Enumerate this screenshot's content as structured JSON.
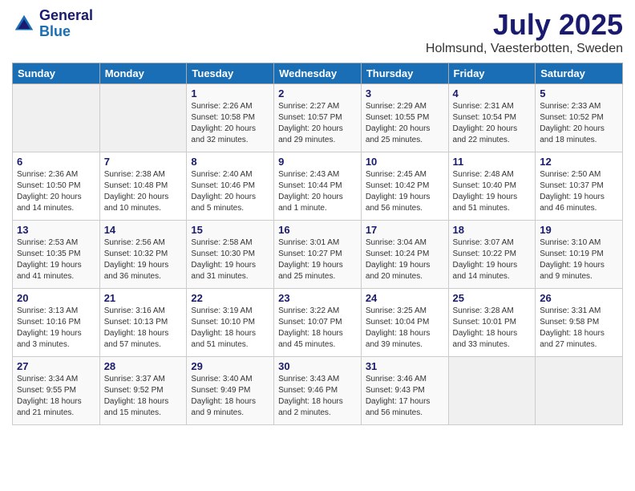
{
  "header": {
    "logo_line1": "General",
    "logo_line2": "Blue",
    "month": "July 2025",
    "location": "Holmsund, Vaesterbotten, Sweden"
  },
  "days_of_week": [
    "Sunday",
    "Monday",
    "Tuesday",
    "Wednesday",
    "Thursday",
    "Friday",
    "Saturday"
  ],
  "weeks": [
    [
      {
        "num": "",
        "info": ""
      },
      {
        "num": "",
        "info": ""
      },
      {
        "num": "1",
        "info": "Sunrise: 2:26 AM\nSunset: 10:58 PM\nDaylight: 20 hours\nand 32 minutes."
      },
      {
        "num": "2",
        "info": "Sunrise: 2:27 AM\nSunset: 10:57 PM\nDaylight: 20 hours\nand 29 minutes."
      },
      {
        "num": "3",
        "info": "Sunrise: 2:29 AM\nSunset: 10:55 PM\nDaylight: 20 hours\nand 25 minutes."
      },
      {
        "num": "4",
        "info": "Sunrise: 2:31 AM\nSunset: 10:54 PM\nDaylight: 20 hours\nand 22 minutes."
      },
      {
        "num": "5",
        "info": "Sunrise: 2:33 AM\nSunset: 10:52 PM\nDaylight: 20 hours\nand 18 minutes."
      }
    ],
    [
      {
        "num": "6",
        "info": "Sunrise: 2:36 AM\nSunset: 10:50 PM\nDaylight: 20 hours\nand 14 minutes."
      },
      {
        "num": "7",
        "info": "Sunrise: 2:38 AM\nSunset: 10:48 PM\nDaylight: 20 hours\nand 10 minutes."
      },
      {
        "num": "8",
        "info": "Sunrise: 2:40 AM\nSunset: 10:46 PM\nDaylight: 20 hours\nand 5 minutes."
      },
      {
        "num": "9",
        "info": "Sunrise: 2:43 AM\nSunset: 10:44 PM\nDaylight: 20 hours\nand 1 minute."
      },
      {
        "num": "10",
        "info": "Sunrise: 2:45 AM\nSunset: 10:42 PM\nDaylight: 19 hours\nand 56 minutes."
      },
      {
        "num": "11",
        "info": "Sunrise: 2:48 AM\nSunset: 10:40 PM\nDaylight: 19 hours\nand 51 minutes."
      },
      {
        "num": "12",
        "info": "Sunrise: 2:50 AM\nSunset: 10:37 PM\nDaylight: 19 hours\nand 46 minutes."
      }
    ],
    [
      {
        "num": "13",
        "info": "Sunrise: 2:53 AM\nSunset: 10:35 PM\nDaylight: 19 hours\nand 41 minutes."
      },
      {
        "num": "14",
        "info": "Sunrise: 2:56 AM\nSunset: 10:32 PM\nDaylight: 19 hours\nand 36 minutes."
      },
      {
        "num": "15",
        "info": "Sunrise: 2:58 AM\nSunset: 10:30 PM\nDaylight: 19 hours\nand 31 minutes."
      },
      {
        "num": "16",
        "info": "Sunrise: 3:01 AM\nSunset: 10:27 PM\nDaylight: 19 hours\nand 25 minutes."
      },
      {
        "num": "17",
        "info": "Sunrise: 3:04 AM\nSunset: 10:24 PM\nDaylight: 19 hours\nand 20 minutes."
      },
      {
        "num": "18",
        "info": "Sunrise: 3:07 AM\nSunset: 10:22 PM\nDaylight: 19 hours\nand 14 minutes."
      },
      {
        "num": "19",
        "info": "Sunrise: 3:10 AM\nSunset: 10:19 PM\nDaylight: 19 hours\nand 9 minutes."
      }
    ],
    [
      {
        "num": "20",
        "info": "Sunrise: 3:13 AM\nSunset: 10:16 PM\nDaylight: 19 hours\nand 3 minutes."
      },
      {
        "num": "21",
        "info": "Sunrise: 3:16 AM\nSunset: 10:13 PM\nDaylight: 18 hours\nand 57 minutes."
      },
      {
        "num": "22",
        "info": "Sunrise: 3:19 AM\nSunset: 10:10 PM\nDaylight: 18 hours\nand 51 minutes."
      },
      {
        "num": "23",
        "info": "Sunrise: 3:22 AM\nSunset: 10:07 PM\nDaylight: 18 hours\nand 45 minutes."
      },
      {
        "num": "24",
        "info": "Sunrise: 3:25 AM\nSunset: 10:04 PM\nDaylight: 18 hours\nand 39 minutes."
      },
      {
        "num": "25",
        "info": "Sunrise: 3:28 AM\nSunset: 10:01 PM\nDaylight: 18 hours\nand 33 minutes."
      },
      {
        "num": "26",
        "info": "Sunrise: 3:31 AM\nSunset: 9:58 PM\nDaylight: 18 hours\nand 27 minutes."
      }
    ],
    [
      {
        "num": "27",
        "info": "Sunrise: 3:34 AM\nSunset: 9:55 PM\nDaylight: 18 hours\nand 21 minutes."
      },
      {
        "num": "28",
        "info": "Sunrise: 3:37 AM\nSunset: 9:52 PM\nDaylight: 18 hours\nand 15 minutes."
      },
      {
        "num": "29",
        "info": "Sunrise: 3:40 AM\nSunset: 9:49 PM\nDaylight: 18 hours\nand 9 minutes."
      },
      {
        "num": "30",
        "info": "Sunrise: 3:43 AM\nSunset: 9:46 PM\nDaylight: 18 hours\nand 2 minutes."
      },
      {
        "num": "31",
        "info": "Sunrise: 3:46 AM\nSunset: 9:43 PM\nDaylight: 17 hours\nand 56 minutes."
      },
      {
        "num": "",
        "info": ""
      },
      {
        "num": "",
        "info": ""
      }
    ]
  ]
}
